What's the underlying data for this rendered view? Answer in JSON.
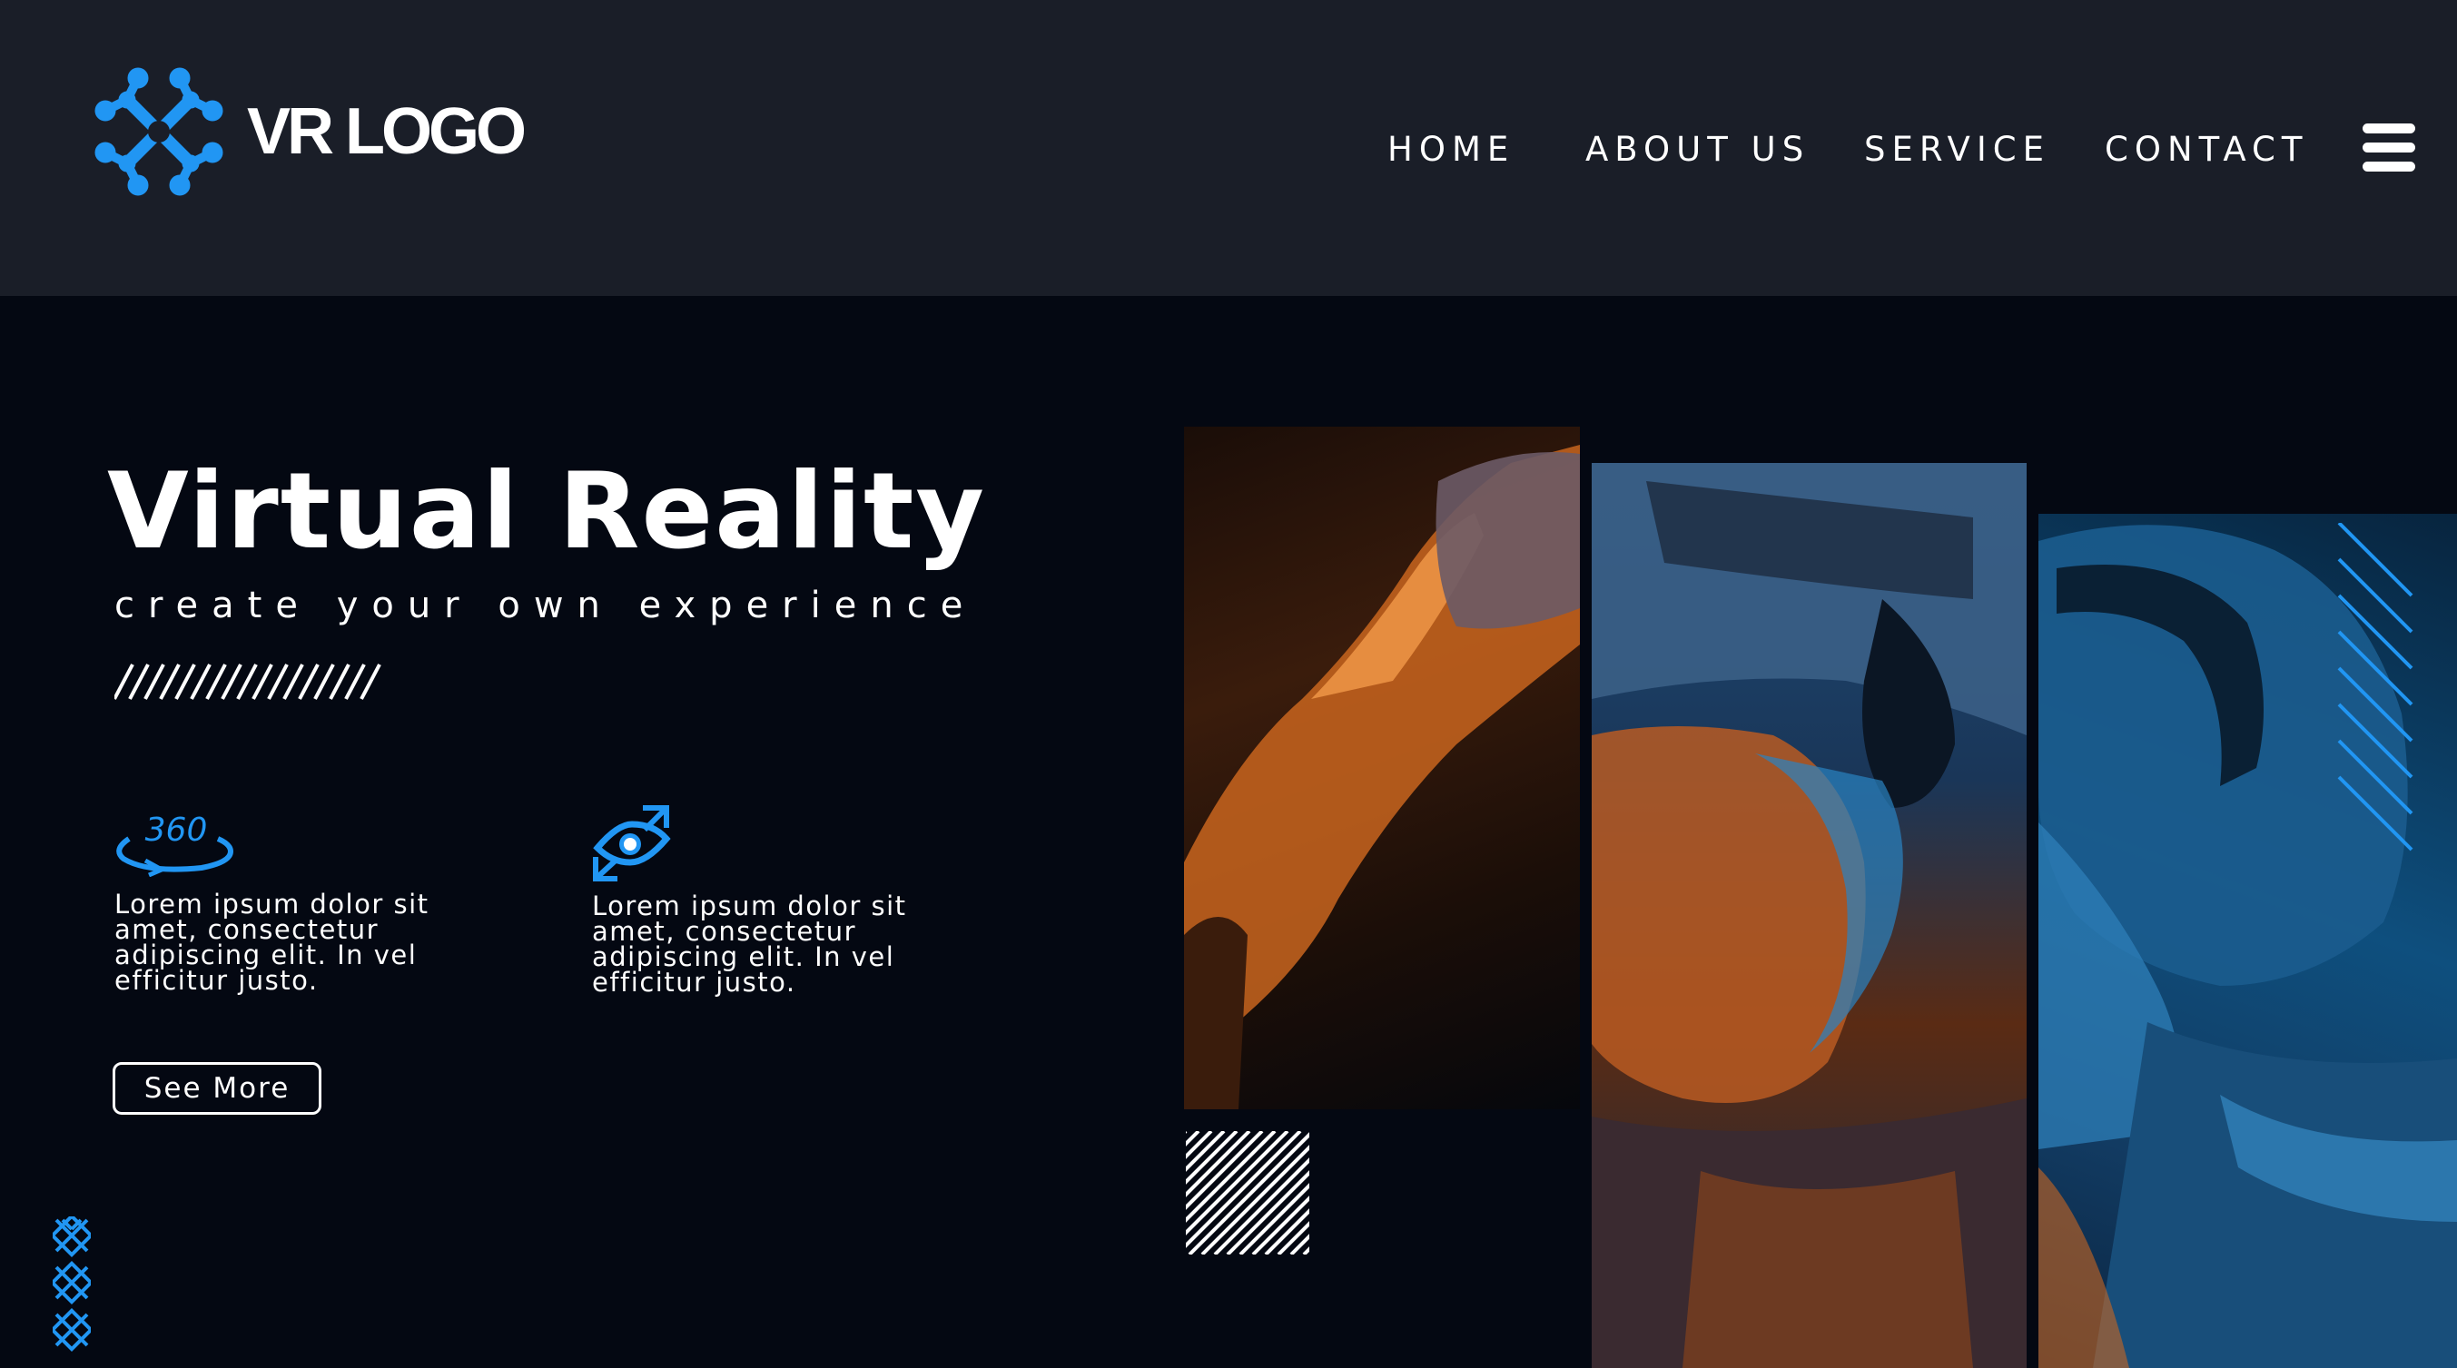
{
  "brand": {
    "logo_text": "VR LOGO",
    "accent_color": "#2196f3",
    "header_bg": "#1a1e28",
    "page_bg": "#040812"
  },
  "nav": {
    "items": [
      {
        "label": "HOME"
      },
      {
        "label": "ABOUT US"
      },
      {
        "label": "SERVICE"
      },
      {
        "label": "CONTACT"
      }
    ],
    "menu_icon": "hamburger-menu-icon"
  },
  "hero": {
    "title": "Virtual Reality",
    "subtitle": "create your own experience"
  },
  "features": [
    {
      "icon": "360-rotate-icon",
      "icon_text": "360",
      "text": "Lorem ipsum dolor sit amet, consectetur adipiscing elit. In vel efficitur justo."
    },
    {
      "icon": "vr-eye-icon",
      "text": "Lorem ipsum dolor sit amet, consectetur adipiscing elit. In vel efficitur justo."
    }
  ],
  "cta": {
    "see_more_label": "See More"
  },
  "image": {
    "description_icon": "vr-headset-photo"
  }
}
